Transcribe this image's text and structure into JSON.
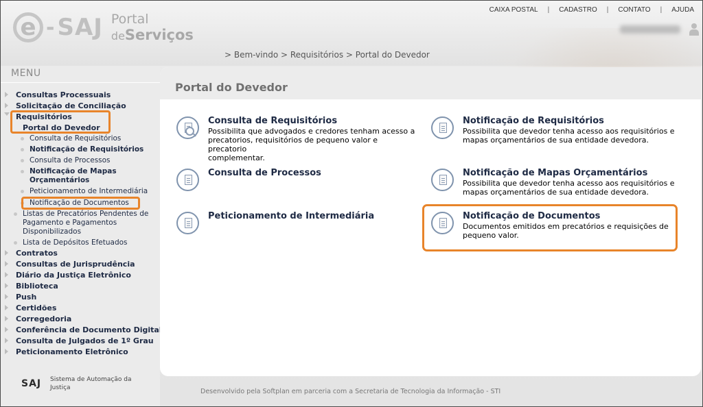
{
  "header": {
    "logo": {
      "brand": "e-SAJ",
      "portal_line1": "Portal",
      "portal_line2_prefix": "de",
      "portal_line2_main": "Serviços"
    },
    "top_links": [
      "CAIXA POSTAL",
      "CADASTRO",
      "CONTATO",
      "AJUDA"
    ],
    "separator": "|",
    "breadcrumb": "> Bem-vindo > Requisitórios > Portal do Devedor"
  },
  "sidebar": {
    "title": "MENU",
    "items": {
      "consultas_processuais": "Consultas Processuais",
      "solicitacao_conciliacao": "Solicitação de Conciliação",
      "requisitorios": "Requisitórios",
      "portal_devedor": "Portal do Devedor",
      "consulta_requisitorios": "Consulta de Requisitórios",
      "notificacao_requisitorios": "Notificação de Requisitórios",
      "consulta_processos": "Consulta de Processos",
      "notificacao_mapas_l1": "Notificação de Mapas",
      "notificacao_mapas_l2": "Orçamentários",
      "peticionamento_intermediaria": "Peticionamento de Intermediária",
      "notificacao_documentos": "Notificação de Documentos",
      "listas_precatorios_l1": "Listas de Precatórios Pendentes de",
      "listas_precatorios_l2": "Pagamento e Pagamentos",
      "listas_precatorios_l3": "Disponibilizados",
      "lista_depositos": "Lista de Depósitos Efetuados",
      "contratos": "Contratos",
      "consultas_jurisprudencia": "Consultas de Jurisprudência",
      "diario_justica": "Diário da Justiça Eletrônico",
      "biblioteca": "Biblioteca",
      "push": "Push",
      "certidoes": "Certidões",
      "corregedoria": "Corregedoria",
      "conferencia_documento": "Conferência de Documento Digital",
      "consulta_julgados": "Consulta de Julgados de 1º Grau",
      "peticionamento_eletronico": "Peticionamento Eletrônico"
    },
    "footer": {
      "logo": "SAJ",
      "text_l1": "Sistema de Automação da",
      "text_l2": "Justiça"
    }
  },
  "main": {
    "page_title": "Portal do Devedor",
    "cards": {
      "consulta_requisitorios": {
        "title": "Consulta de Requisitórios",
        "desc_l1": "Possibilita que advogados e credores tenham acesso a",
        "desc_l2": "precatorios, requisitórios de pequeno valor e precatorio",
        "desc_l3": "complementar."
      },
      "notificacao_requisitorios": {
        "title": "Notificação de Requisitórios",
        "desc_l1": "Possibilita que devedor tenha acesso aos requisitórios e",
        "desc_l2": "mapas orçamentários de sua entidade devedora."
      },
      "consulta_processos": {
        "title": "Consulta de Processos"
      },
      "notificacao_mapas": {
        "title": "Notificação de Mapas Orçamentários",
        "desc_l1": "Possibilita que devedor tenha acesso aos requisitórios e",
        "desc_l2": "mapas orçamentários de sua entidade devedora."
      },
      "peticionamento_intermediaria": {
        "title": "Peticionamento de Intermediária"
      },
      "notificacao_documentos": {
        "title": "Notificação de Documentos",
        "desc_l1": "Documentos emitidos em precatórios e requisições de",
        "desc_l2": "pequeno valor."
      }
    },
    "footer_credit": "Desenvolvido pela Softplan em parceria com a Secretaria de Tecnologia da Informação - STI"
  },
  "colors": {
    "highlight": "#e8842a",
    "link_text": "#1e2a44",
    "icon_ring": "#7f93ad"
  }
}
